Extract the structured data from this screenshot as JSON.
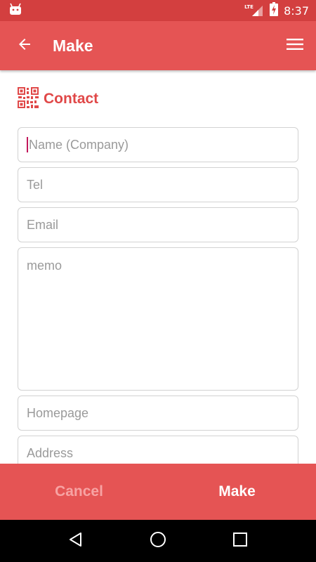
{
  "status_bar": {
    "network": "LTE",
    "time": "8:37",
    "icons": [
      "android-icon",
      "lte-signal-icon",
      "battery-charging-icon"
    ]
  },
  "app_bar": {
    "title": "Make",
    "back_icon": "arrow-left-icon",
    "menu_icon": "hamburger-menu-icon"
  },
  "section": {
    "title": "Contact",
    "icon": "qr-code-icon"
  },
  "form": {
    "name_placeholder": "Name (Company)",
    "tel_placeholder": "Tel",
    "email_placeholder": "Email",
    "memo_placeholder": "memo",
    "homepage_placeholder": "Homepage",
    "address_placeholder": "Address"
  },
  "bottom_bar": {
    "cancel_label": "Cancel",
    "make_label": "Make"
  },
  "nav_bar": {
    "icons": [
      "back-triangle-icon",
      "home-circle-icon",
      "recents-square-icon"
    ]
  },
  "colors": {
    "primary": "#e55454",
    "status_bar": "#d33f3f",
    "accent_text": "#e04848",
    "cancel_text": "#f7a3a3",
    "field_border": "#d2d2d2",
    "placeholder": "#9a9a9a",
    "caret": "#c2185b"
  }
}
